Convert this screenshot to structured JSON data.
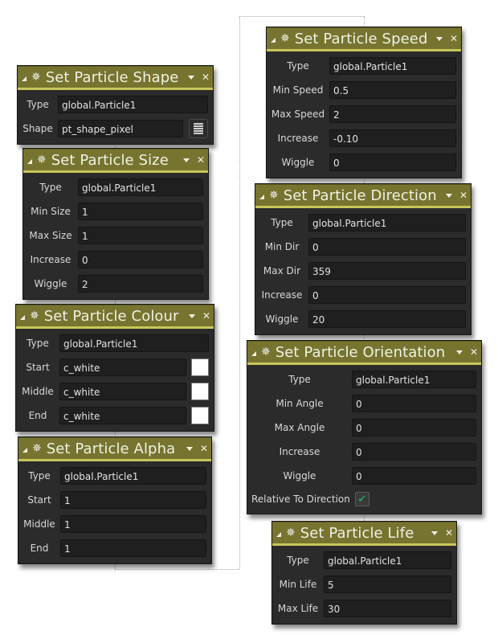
{
  "icons": {
    "collapse": "collapse-triangle-icon",
    "particle": "particle-sparkle-icon",
    "menu": "chevron-down-icon",
    "close": "close-icon"
  },
  "panels": {
    "shape": {
      "title": "Set Particle Shape",
      "rows": [
        {
          "label": "Type",
          "value": "global.Particle1"
        },
        {
          "label": "Shape",
          "value": "pt_shape_pixel"
        }
      ]
    },
    "size": {
      "title": "Set Particle Size",
      "rows": [
        {
          "label": "Type",
          "value": "global.Particle1"
        },
        {
          "label": "Min Size",
          "value": "1"
        },
        {
          "label": "Max Size",
          "value": "1"
        },
        {
          "label": "Increase",
          "value": "0"
        },
        {
          "label": "Wiggle",
          "value": "2"
        }
      ]
    },
    "colour": {
      "title": "Set Particle Colour",
      "rows": [
        {
          "label": "Type",
          "value": "global.Particle1"
        },
        {
          "label": "Start",
          "value": "c_white",
          "swatch": "#ffffff"
        },
        {
          "label": "Middle",
          "value": "c_white",
          "swatch": "#ffffff"
        },
        {
          "label": "End",
          "value": "c_white",
          "swatch": "#ffffff"
        }
      ]
    },
    "alpha": {
      "title": "Set Particle Alpha",
      "rows": [
        {
          "label": "Type",
          "value": "global.Particle1"
        },
        {
          "label": "Start",
          "value": "1"
        },
        {
          "label": "Middle",
          "value": "1"
        },
        {
          "label": "End",
          "value": "1"
        }
      ]
    },
    "speed": {
      "title": "Set Particle Speed",
      "rows": [
        {
          "label": "Type",
          "value": "global.Particle1"
        },
        {
          "label": "Min Speed",
          "value": "0.5"
        },
        {
          "label": "Max Speed",
          "value": "2"
        },
        {
          "label": "Increase",
          "value": "-0.10"
        },
        {
          "label": "Wiggle",
          "value": "0"
        }
      ]
    },
    "direction": {
      "title": "Set Particle Direction",
      "rows": [
        {
          "label": "Type",
          "value": "global.Particle1"
        },
        {
          "label": "Min Dir",
          "value": "0"
        },
        {
          "label": "Max Dir",
          "value": "359"
        },
        {
          "label": "Increase",
          "value": "0"
        },
        {
          "label": "Wiggle",
          "value": "20"
        }
      ]
    },
    "orientation": {
      "title": "Set Particle Orientation",
      "rows": [
        {
          "label": "Type",
          "value": "global.Particle1"
        },
        {
          "label": "Min Angle",
          "value": "0"
        },
        {
          "label": "Max Angle",
          "value": "0"
        },
        {
          "label": "Increase",
          "value": "0"
        },
        {
          "label": "Wiggle",
          "value": "0"
        }
      ],
      "checkbox": {
        "label": "Relative To Direction",
        "checked": true
      }
    },
    "life": {
      "title": "Set Particle Life",
      "rows": [
        {
          "label": "Type",
          "value": "global.Particle1"
        },
        {
          "label": "Min Life",
          "value": "5"
        },
        {
          "label": "Max Life",
          "value": "30"
        }
      ]
    }
  },
  "colors": {
    "header": "#76742f",
    "header_accent": "#c8c65a",
    "panel_bg": "#2b2b2b",
    "check": "#1fa05a"
  }
}
